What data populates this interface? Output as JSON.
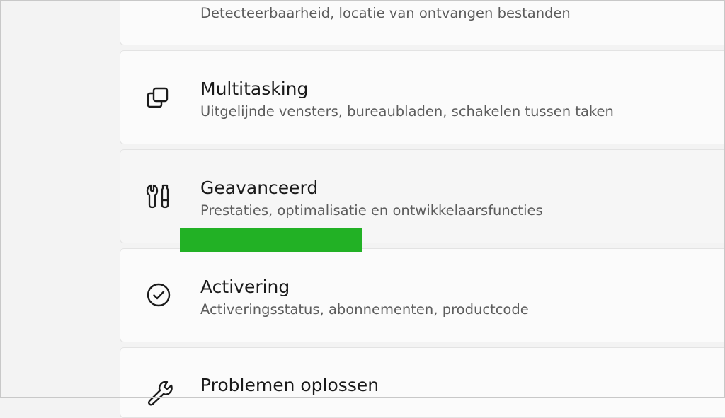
{
  "theme": {
    "highlight_color": "#22b125"
  },
  "settings": {
    "items": [
      {
        "icon": "nearby-sharing-icon",
        "title": "",
        "subtitle": "Detecteerbaarheid, locatie van ontvangen bestanden"
      },
      {
        "icon": "multitasking-icon",
        "title": "Multitasking",
        "subtitle": "Uitgelijnde vensters, bureaubladen, schakelen tussen taken"
      },
      {
        "icon": "advanced-tools-icon",
        "title": "Geavanceerd",
        "subtitle": "Prestaties, optimalisatie en ontwikkelaarsfuncties",
        "hovered": true
      },
      {
        "icon": "check-circle-icon",
        "title": "Activering",
        "subtitle": "Activeringsstatus, abonnementen, productcode"
      },
      {
        "icon": "wrench-icon",
        "title": "Problemen oplossen",
        "subtitle": ""
      }
    ]
  }
}
